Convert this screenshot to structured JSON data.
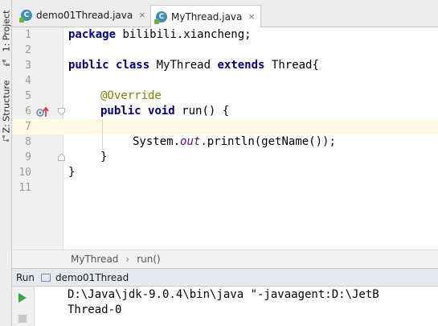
{
  "side_strip": {
    "project_tab": "1: Project",
    "structure_tab": "Z: Structure"
  },
  "tabs": [
    {
      "icon": "class-icon",
      "label": "demo01Thread.java",
      "close": "×",
      "active": false
    },
    {
      "icon": "class-icon",
      "label": "MyThread.java",
      "close": "×",
      "active": true
    }
  ],
  "editor": {
    "line_numbers": [
      "1",
      "2",
      "3",
      "4",
      "5",
      "6",
      "7",
      "8",
      "9",
      "10",
      "11"
    ],
    "current_line": 7,
    "code": {
      "line1": {
        "kw": "package",
        "rest": " bilibili.xiancheng;"
      },
      "line3": {
        "kw1": "public",
        "kw2": "class",
        "name": " MyThread ",
        "kw3": "extends",
        "rest": " Thread{"
      },
      "line5": {
        "annotation": "@Override"
      },
      "line6": {
        "kw1": "public",
        "kw2": "void",
        "rest": " run() {"
      },
      "line8": {
        "before": "System.",
        "field": "out",
        "after": ".println(getName());"
      },
      "line9": {
        "text": "}"
      },
      "line10": {
        "text": "}"
      }
    },
    "gutter_icons": {
      "override_icon": "overrides-method-icon",
      "fold_icon": "fold-icon"
    }
  },
  "breadcrumb": {
    "items": [
      "MyThread",
      "run()"
    ],
    "separator": "›"
  },
  "run_panel": {
    "title": "Run",
    "config_name": "demo01Thread",
    "console": [
      "D:\\Java\\jdk-9.0.4\\bin\\java \"-javaagent:D:\\JetB",
      "Thread-0"
    ],
    "toolbar": [
      "run-icon",
      "up-arrow-icon",
      "stop-icon",
      "down-arrow-icon"
    ]
  },
  "colors": {
    "keyword": "#000080",
    "annotation": "#808000",
    "static_field": "#660e7a",
    "caret_row": "#fffae3",
    "run_green": "#3fa33f",
    "class_icon": "#3d8fb5"
  }
}
